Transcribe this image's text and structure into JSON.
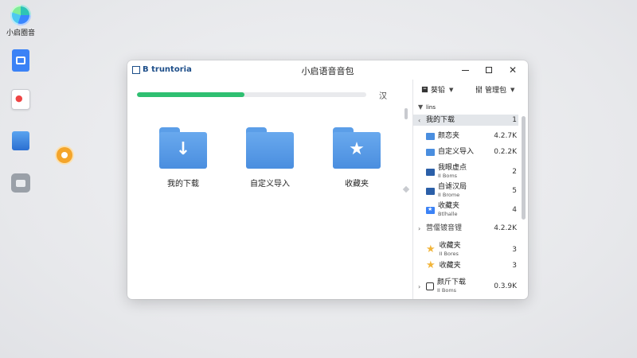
{
  "desktop": {
    "icons": [
      {
        "label": "小启圈音",
        "icon": "app-orb-icon"
      },
      {
        "label": "",
        "icon": "document-icon"
      },
      {
        "label": "",
        "icon": "card-icon"
      },
      {
        "label": "",
        "icon": "monitor-icon"
      },
      {
        "label": "",
        "icon": "gadget-icon"
      }
    ]
  },
  "window": {
    "app_name": "B truntoria",
    "title": "小启语音音包",
    "controls": {
      "close": "✕"
    }
  },
  "progress": {
    "fraction": 0.47,
    "label": "汉"
  },
  "folders": [
    {
      "label": "我的下载",
      "glyph": "↓"
    },
    {
      "label": "自定义导入",
      "glyph": ""
    },
    {
      "label": "收藏夹",
      "glyph": "★"
    }
  ],
  "toolbar": {
    "sort_label": "葵铅",
    "manage_label": "管理包"
  },
  "list": {
    "header": "lins",
    "items": [
      {
        "name": "我的下载",
        "sub": "",
        "value": "1",
        "icon": "caret",
        "group": true
      },
      {
        "name": "颜恋夹",
        "sub": "",
        "value": "4.2.7K",
        "icon": "folder"
      },
      {
        "name": "自定义导入",
        "sub": "",
        "value": "0.2.2K",
        "icon": "folder"
      },
      {
        "name": "我眼虚点",
        "sub": "II Boms",
        "value": "2",
        "icon": "folder-dark"
      },
      {
        "name": "自谑汉局",
        "sub": "II Brome",
        "value": "5",
        "icon": "folder-dark"
      },
      {
        "name": "收藏夹",
        "sub": "Btlhalle",
        "value": "4",
        "icon": "folder-star"
      },
      {
        "name": "营偃镀音锂",
        "sub": "",
        "value": "4.2.2K",
        "icon": "chevron",
        "group": true
      },
      {
        "name": "收藏夹",
        "sub": "II Bores",
        "value": "3",
        "icon": "star"
      },
      {
        "name": "收藏夹",
        "sub": "",
        "value": "3",
        "icon": "star"
      },
      {
        "name": "颜斤下载",
        "sub": "II Boms",
        "value": "0.3.9K",
        "icon": "download",
        "group": true
      }
    ]
  },
  "colors": {
    "accent": "#2fbf71",
    "folder": "#4a8edf",
    "star": "#f2b53b",
    "orange_dot": "#f4a52b"
  }
}
